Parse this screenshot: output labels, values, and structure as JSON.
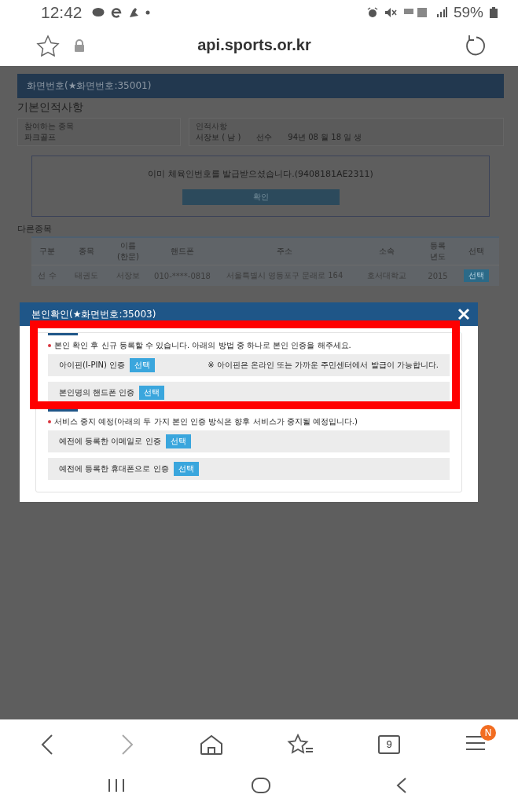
{
  "status_bar": {
    "time": "12:42",
    "battery": "59%"
  },
  "browser": {
    "url": "api.sports.or.kr"
  },
  "page": {
    "header": "화면번호(★화면번호:35001)",
    "section_title": "기본인적사항",
    "fields": [
      {
        "label": "참여하는 종목",
        "value": "파크골프"
      },
      {
        "label": "인적사항",
        "value": "서장보 ( 남 )　　선수　　94년 08 월 18 일 생"
      }
    ],
    "notice": {
      "message": "이미 체육인번호를 발급받으셨습니다.(9408181AE2311)",
      "button": "확인"
    },
    "table": {
      "title": "다른종목",
      "columns": [
        "구분",
        "종목",
        "이름\n(한문)",
        "핸드폰",
        "주소",
        "소속",
        "등록\n년도",
        "선택"
      ],
      "rows": [
        {
          "cells": [
            "선 수",
            "태권도",
            "서장보",
            "010-****-0818",
            "서울특별시 영등포구 문래로 164",
            "호서대학교",
            "2015"
          ],
          "button": "선택"
        }
      ]
    }
  },
  "modal": {
    "title": "본인확인(★화면번호:35003)",
    "sections": [
      {
        "notice": "본인 확인 후 신규 등록할 수 있습니다. 아래의 방법 중 하나로 본인 인증을 해주세요.",
        "options": [
          {
            "label": "아이핀(I-PIN) 인증",
            "button": "선택",
            "note": "※  아이핀은 온라인 또는 가까운 주민센터에서 발급이 가능합니다."
          },
          {
            "label": "본인명의 핸드폰 인증",
            "button": "선택"
          }
        ]
      },
      {
        "notice": "서비스 중지 예정(아래의 두 가지 본인 인증 방식은 향후 서비스가 중지될 예정입니다.)",
        "options": [
          {
            "label": "예전에 등록한 이메일로 인증",
            "button": "선택"
          },
          {
            "label": "예전에 등록한 휴대폰으로 인증",
            "button": "선택"
          }
        ]
      }
    ],
    "highlight": true
  },
  "bottom_nav": {
    "tab_count": "9",
    "menu_badge": "N"
  }
}
